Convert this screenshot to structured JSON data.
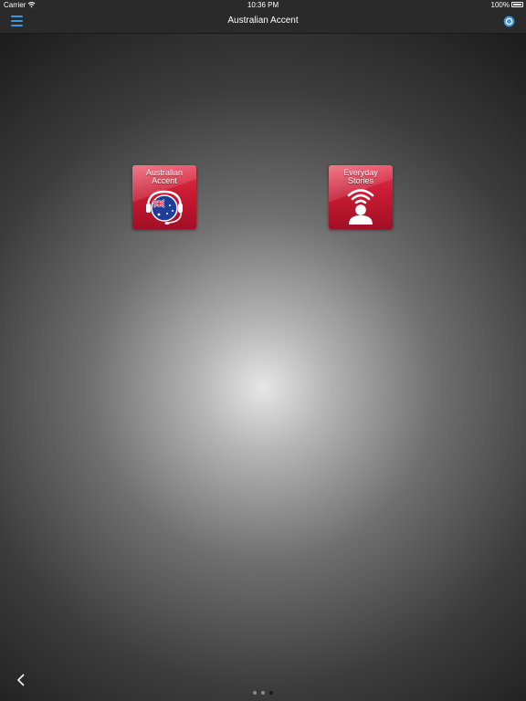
{
  "status_bar": {
    "carrier": "Carrier",
    "time": "10:36 PM",
    "battery": "100%",
    "wifi_icon": "wifi-icon",
    "battery_icon": "battery-full-icon"
  },
  "nav_bar": {
    "title": "Australian Accent",
    "menu_icon": "hamburger-menu-icon",
    "settings_icon": "settings-icon",
    "accent_color": "#3d98e0"
  },
  "apps": [
    {
      "line1": "Australian",
      "line2": "Accent",
      "icon": "globe-headset-icon"
    },
    {
      "line1": "Everyday",
      "line2": "Stories",
      "icon": "person-broadcast-icon"
    }
  ],
  "tile_color": "#c81b33",
  "pager": {
    "page_count": 3,
    "active_index": 2
  },
  "back_icon": "chevron-left-icon"
}
